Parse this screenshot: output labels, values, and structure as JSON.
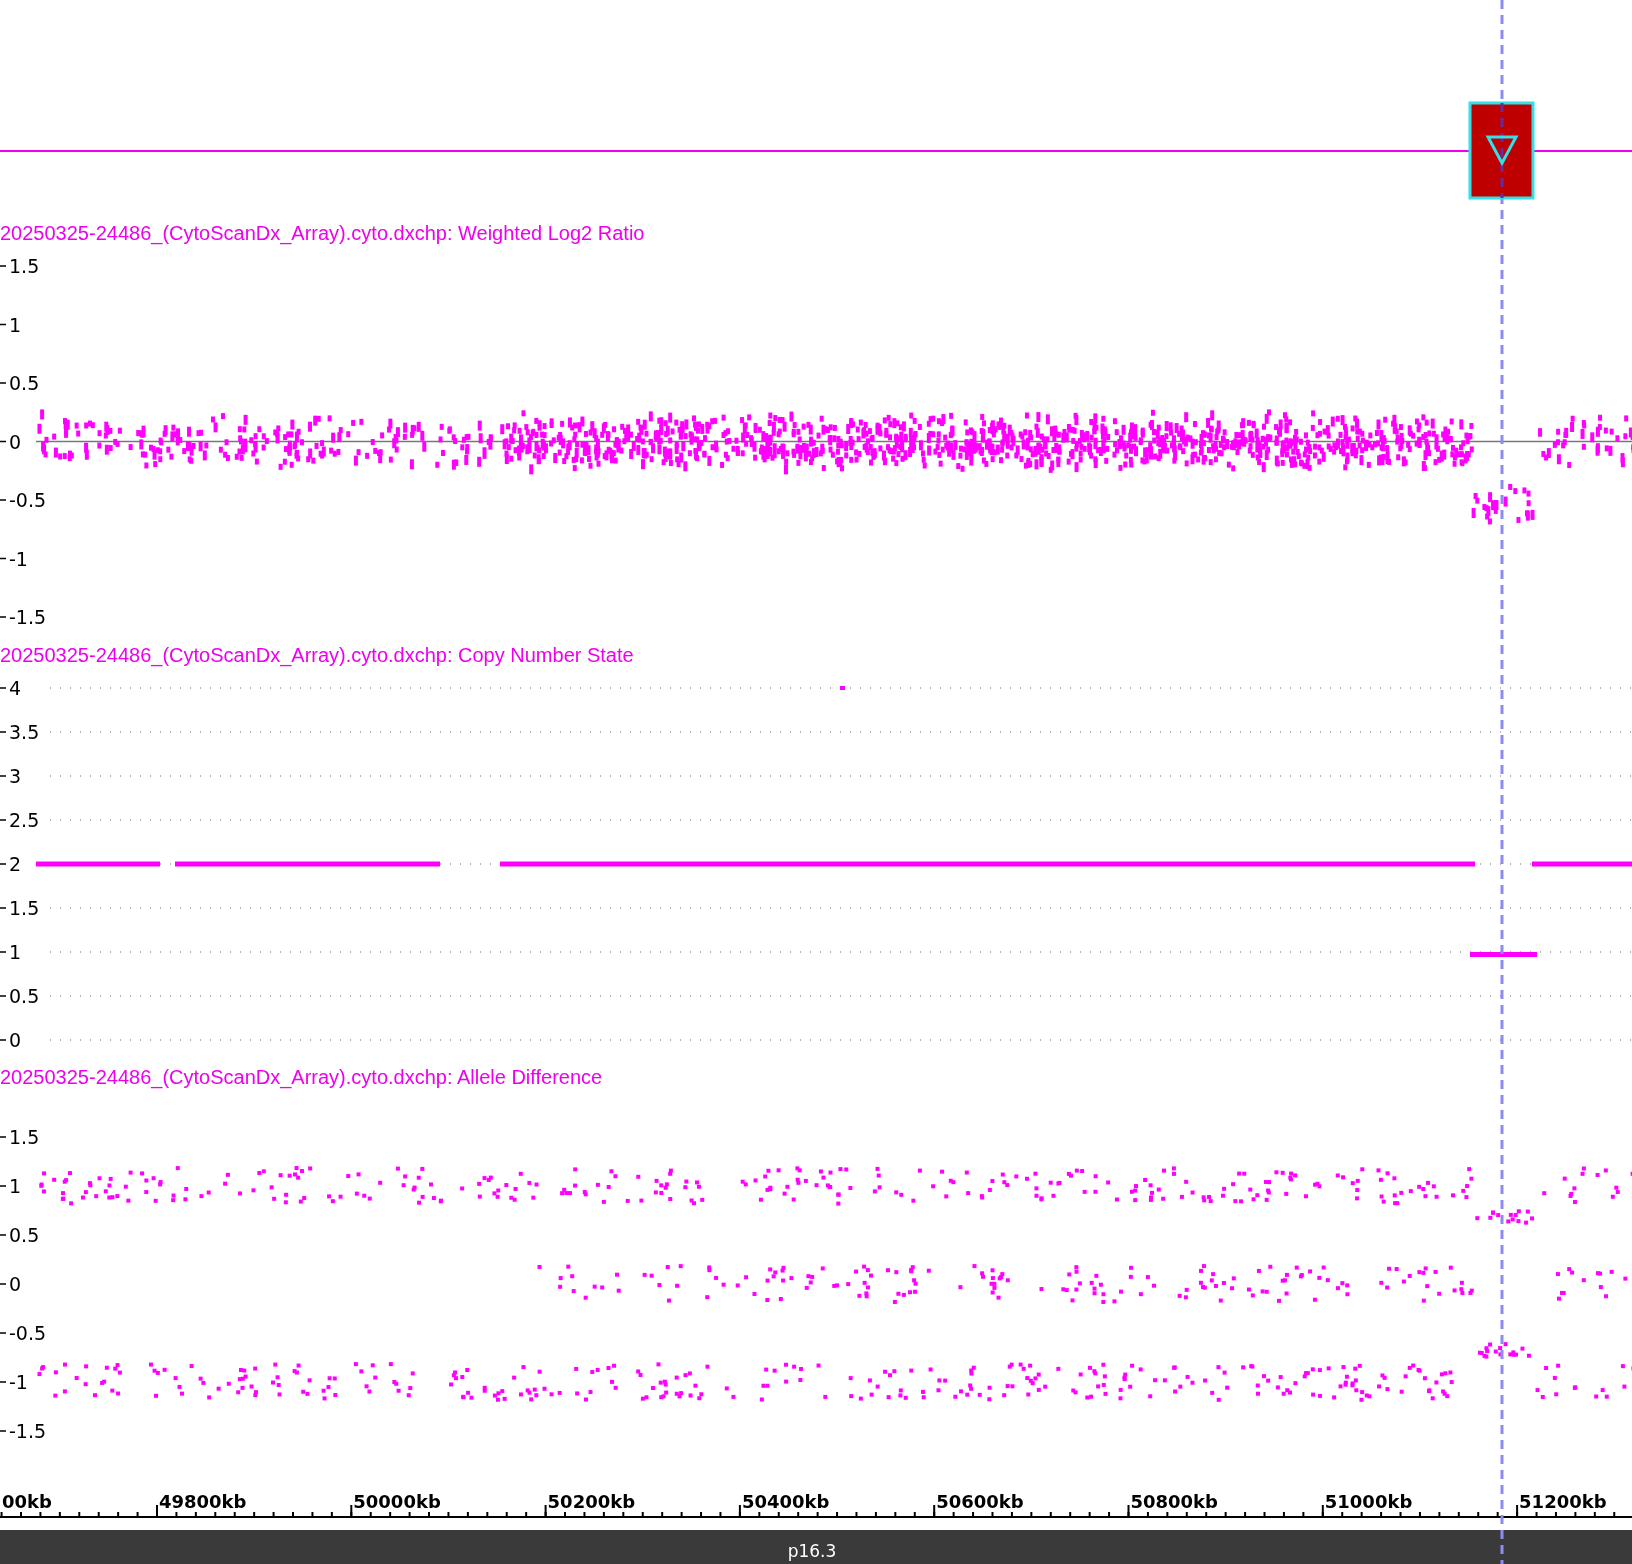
{
  "tracks": [
    {
      "kind": "log2",
      "title": "20250325-24486_(CytoScanDx_Array).cyto.dxchp: Weighted Log2 Ratio",
      "ticks": [
        "1.5",
        "1",
        "0.5",
        "0",
        "-0.5",
        "-1",
        "-1.5"
      ]
    },
    {
      "kind": "copy_number",
      "title": "20250325-24486_(CytoScanDx_Array).cyto.dxchp: Copy Number State",
      "ticks": [
        "4",
        "3.5",
        "3",
        "2.5",
        "2",
        "1.5",
        "1",
        "0.5",
        "0"
      ]
    },
    {
      "kind": "allele",
      "title": "20250325-24486_(CytoScanDx_Array).cyto.dxchp: Allele Difference",
      "ticks": [
        "1.5",
        "1",
        "0.5",
        "0",
        "-0.5",
        "-1",
        "-1.5"
      ]
    }
  ],
  "axis": {
    "labels": [
      "00kb",
      "49800kb",
      "50000kb",
      "50200kb",
      "50400kb",
      "50600kb",
      "50800kb",
      "51000kb",
      "51200kb"
    ]
  },
  "band": {
    "label": "p16.3"
  }
}
